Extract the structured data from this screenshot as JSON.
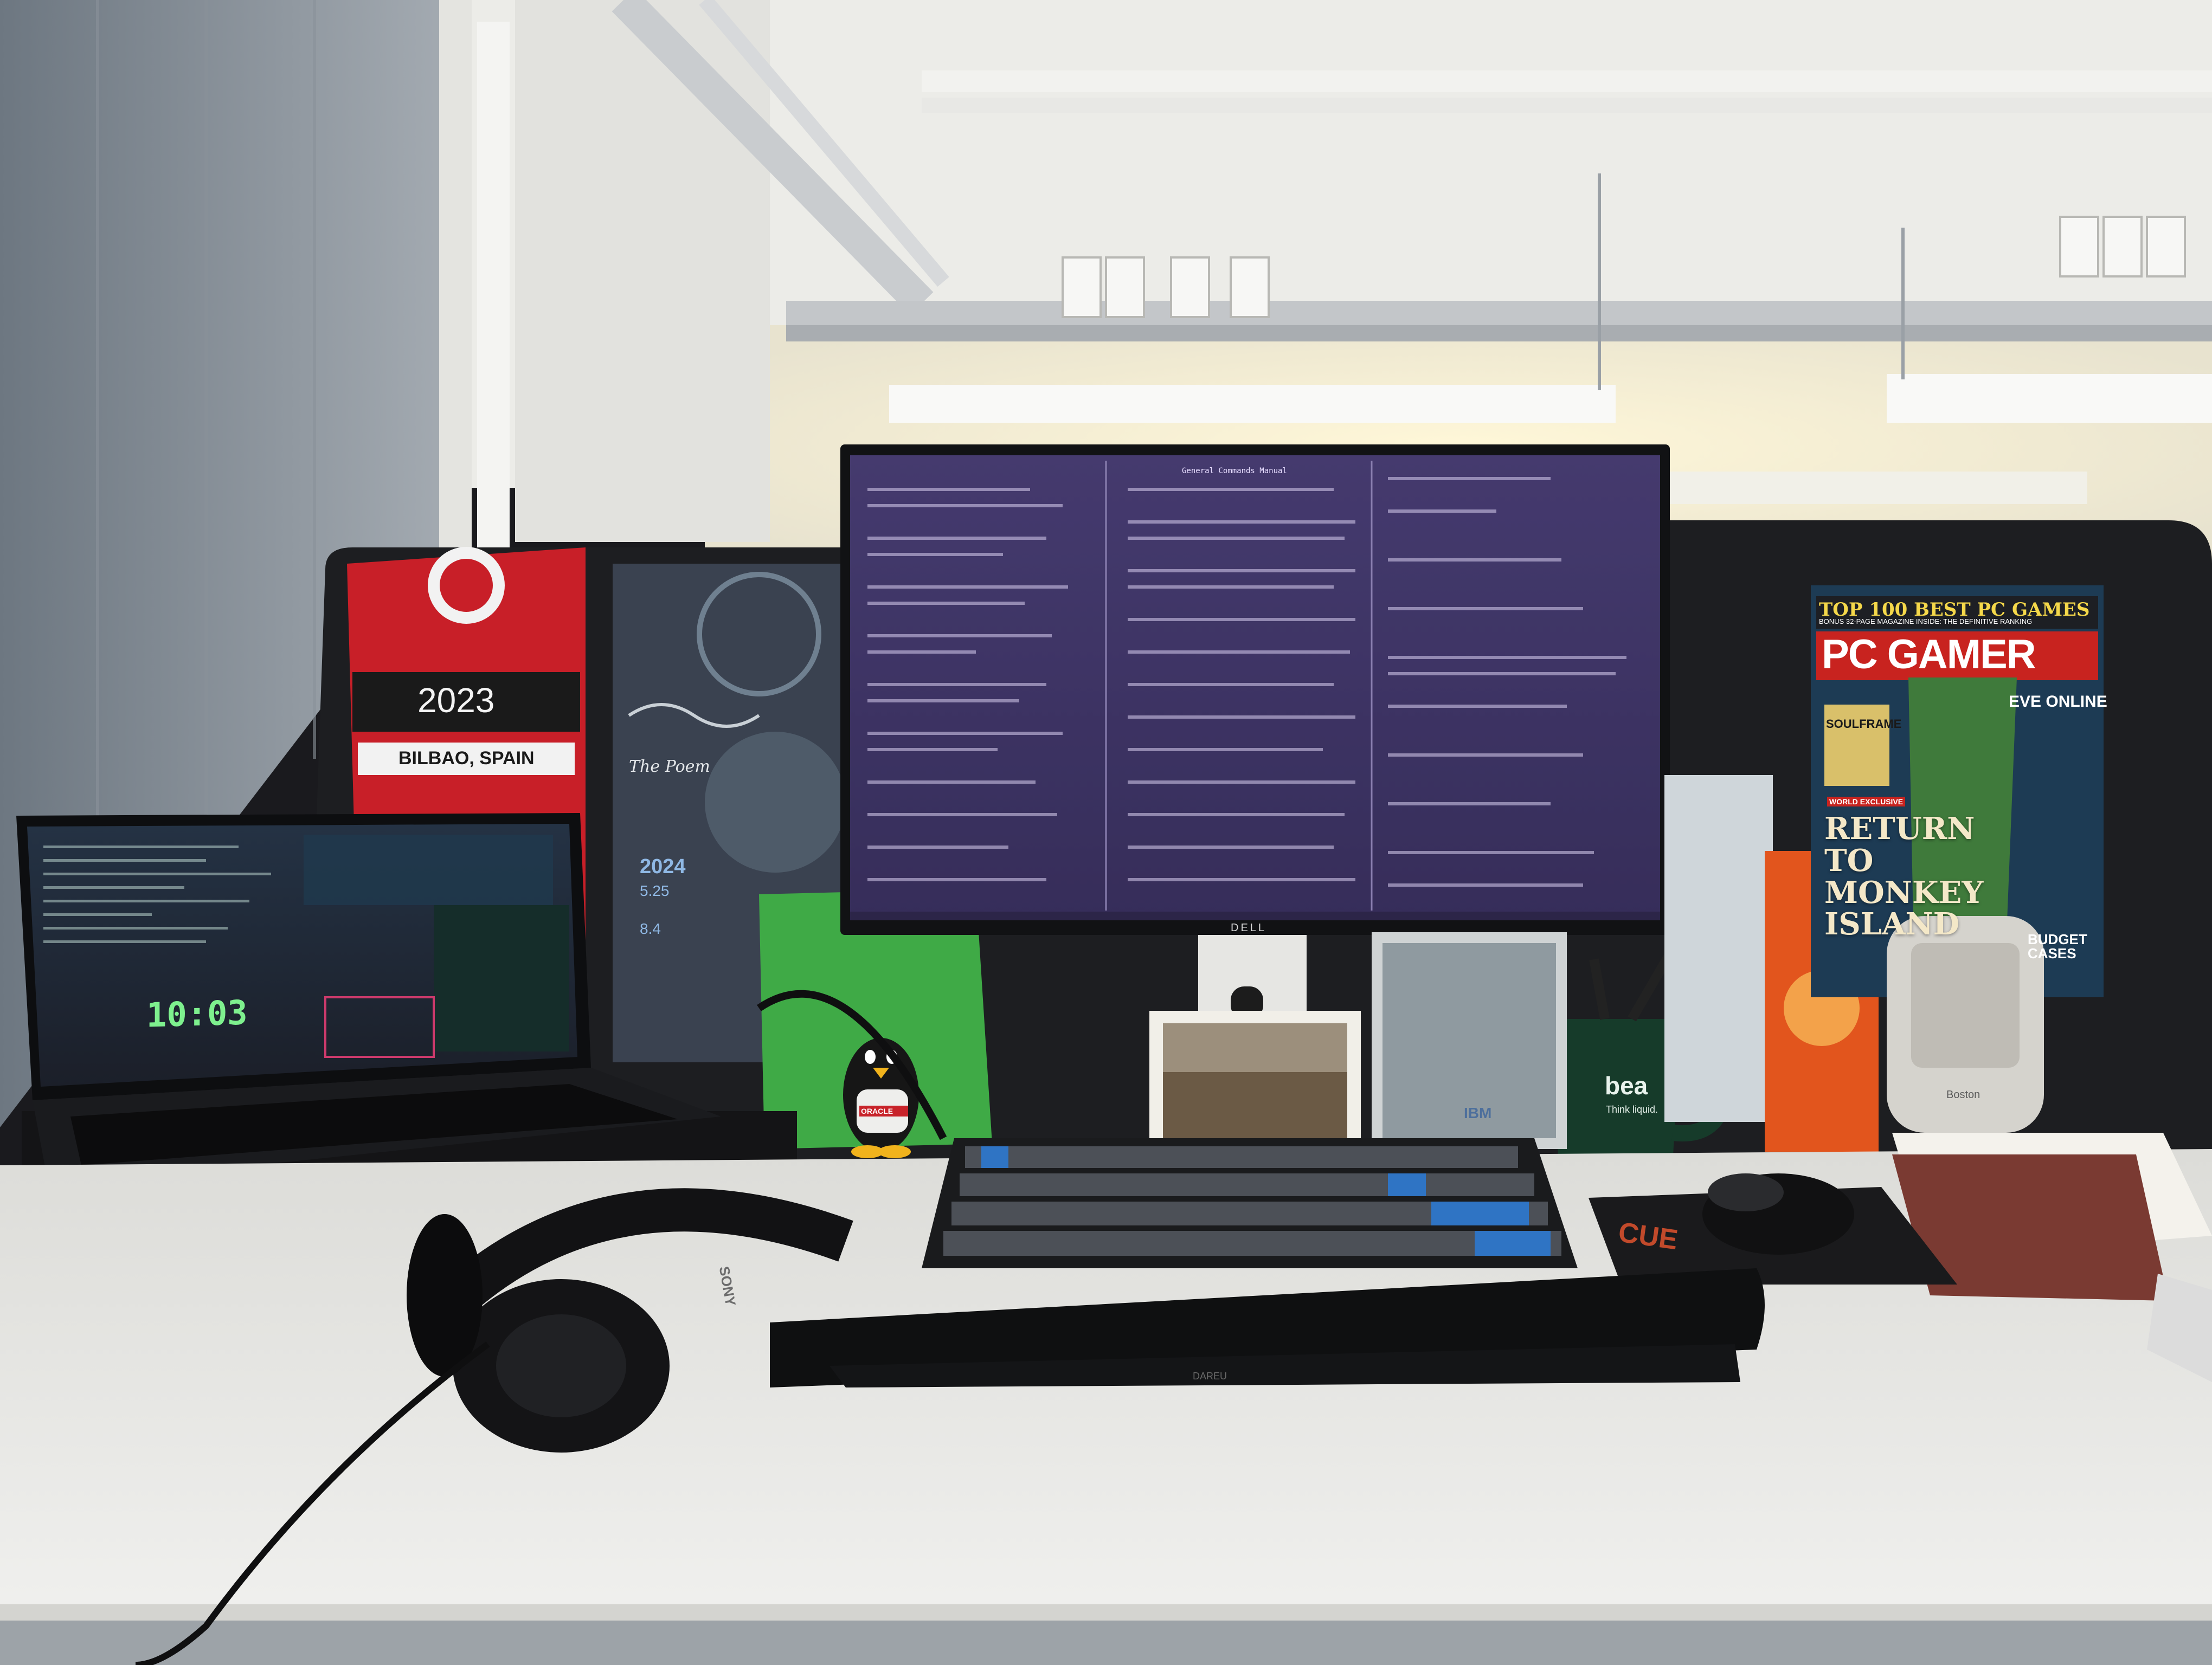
{
  "scene": {
    "description_free": true
  },
  "scarf": {
    "year": "2023",
    "city": "BILBAO, SPAIN"
  },
  "poster": {
    "signature": "The Poem",
    "year": "2024",
    "dates": [
      "5.25",
      "8.4"
    ]
  },
  "laptop": {
    "clock": "10:03"
  },
  "monitor": {
    "header": "General Commands Manual",
    "brand": "DELL"
  },
  "magazine": {
    "masthead": "PC GAMER",
    "headline": "TOP 100 BEST PC GAMES",
    "subline": "BONUS 32-PAGE MAGAZINE INSIDE: THE DEFINITIVE RANKING",
    "cover_story": "RETURN TO MONKEY ISLAND",
    "side_1": "EVE ONLINE",
    "side_2": "SOULFRAME",
    "side_3": "BUDGET CASES",
    "exclusive": "WORLD EXCLUSIVE"
  },
  "mug": {
    "logo": "bea",
    "tagline": "Think liquid."
  },
  "tux_badge": "IBM",
  "speaker": {
    "brand": "Boston"
  },
  "mousepad": {
    "logo": "CUE"
  },
  "headphones": {
    "brand": "SONY"
  },
  "wristrest": {
    "brand": "DAREU"
  },
  "figurine": {
    "shirt": "ORACLE"
  },
  "colors": {
    "wall": "#d8d8d2",
    "ceiling": "#eeeeea",
    "desk": "#e7e7e4",
    "partition": "#1e1f22",
    "monitor_bg": "#453a6e",
    "terminal_text": "#d9cff0",
    "scarf_red": "#c81f28",
    "magazine_red": "#c8231f",
    "keyboard_blue": "#2f74c4"
  }
}
